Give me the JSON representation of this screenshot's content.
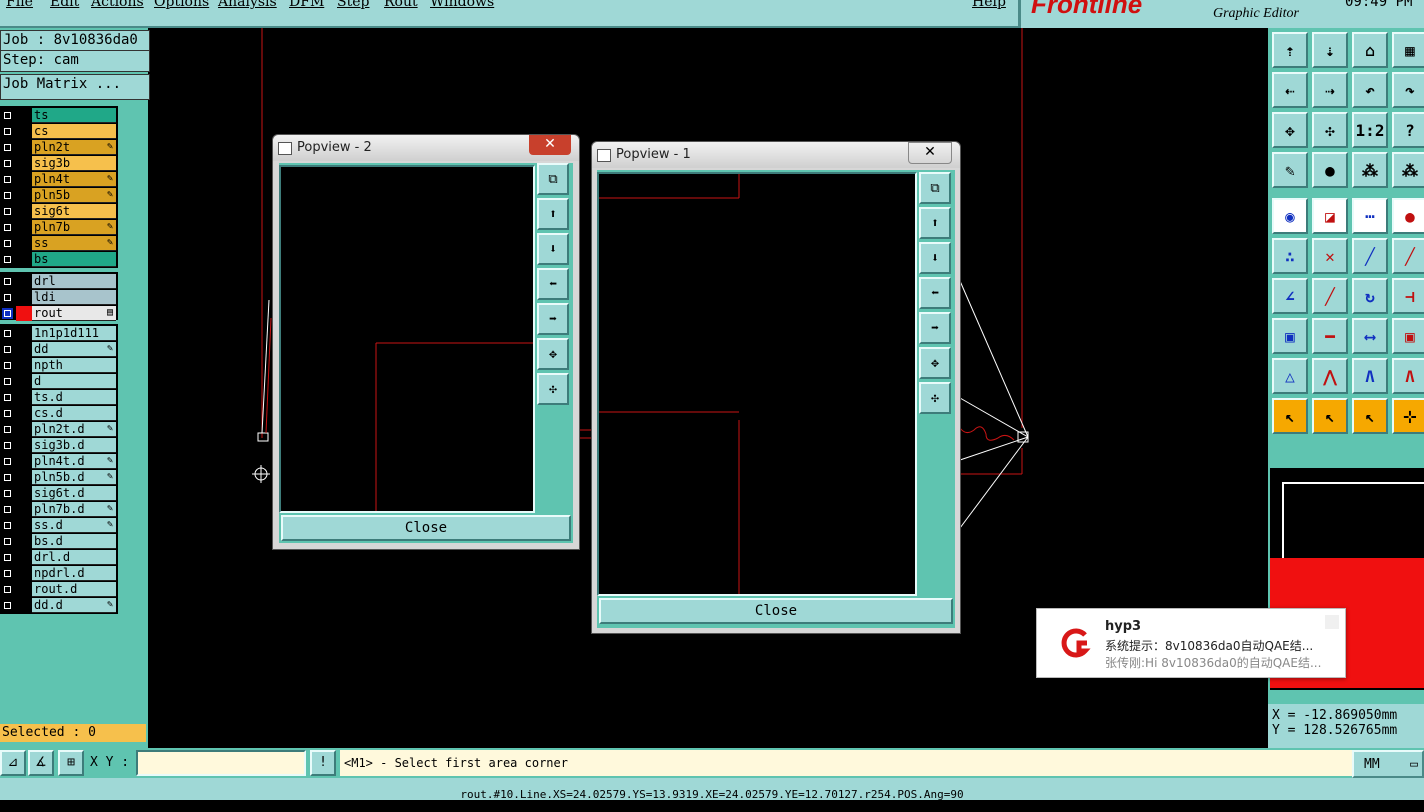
{
  "menu": {
    "items": [
      "File",
      "Edit",
      "Actions",
      "Options",
      "Analysis",
      "DFM",
      "Step",
      "Rout",
      "Windows",
      "Help"
    ]
  },
  "brand": {
    "logo": "Frontline",
    "subtitle": "Graphic Editor",
    "clock": "09:49 PM"
  },
  "job": {
    "job_label": "Job : 8v10836da0",
    "step_label": "Step: cam",
    "matrix_label": "Job Matrix ..."
  },
  "layers": {
    "board": [
      {
        "name": "ts",
        "color": "#20a888",
        "mark": ""
      },
      {
        "name": "cs",
        "color": "#f6c04c",
        "mark": ""
      },
      {
        "name": "pln2t",
        "color": "#d9a222",
        "mark": "✎"
      },
      {
        "name": "sig3b",
        "color": "#f6c04c",
        "mark": ""
      },
      {
        "name": "pln4t",
        "color": "#d9a222",
        "mark": "✎"
      },
      {
        "name": "pln5b",
        "color": "#d9a222",
        "mark": "✎"
      },
      {
        "name": "sig6t",
        "color": "#f6c04c",
        "mark": ""
      },
      {
        "name": "pln7b",
        "color": "#d9a222",
        "mark": "✎"
      },
      {
        "name": "ss",
        "color": "#d9a222",
        "mark": "✎"
      },
      {
        "name": "bs",
        "color": "#20a888",
        "mark": ""
      }
    ],
    "drill": [
      {
        "name": "drl",
        "color": "#a8c4cc",
        "mark": ""
      },
      {
        "name": "ldi",
        "color": "#a8c4cc",
        "mark": ""
      },
      {
        "name": "rout",
        "color": "#e8e8e8",
        "mark": "▤",
        "active": true
      }
    ],
    "misc": [
      {
        "name": "1n1p1d111",
        "mark": ""
      },
      {
        "name": "dd",
        "mark": "✎"
      },
      {
        "name": "npth",
        "mark": ""
      },
      {
        "name": "d",
        "mark": ""
      },
      {
        "name": "ts.d",
        "mark": ""
      },
      {
        "name": "cs.d",
        "mark": ""
      },
      {
        "name": "pln2t.d",
        "mark": "✎"
      },
      {
        "name": "sig3b.d",
        "mark": ""
      },
      {
        "name": "pln4t.d",
        "mark": "✎"
      },
      {
        "name": "pln5b.d",
        "mark": "✎"
      },
      {
        "name": "sig6t.d",
        "mark": ""
      },
      {
        "name": "pln7b.d",
        "mark": "✎"
      },
      {
        "name": "ss.d",
        "mark": "✎"
      },
      {
        "name": "bs.d",
        "mark": ""
      },
      {
        "name": "drl.d",
        "mark": ""
      },
      {
        "name": "npdrl.d",
        "mark": ""
      },
      {
        "name": "rout.d",
        "mark": ""
      },
      {
        "name": "dd.d",
        "mark": "✎"
      }
    ]
  },
  "selected": "Selected : 0",
  "popview2": {
    "title": "Popview - 2",
    "close": "Close"
  },
  "popview1": {
    "title": "Popview - 1",
    "close": "Close"
  },
  "commandline": {
    "xy_label": "X Y :",
    "xy_value": "",
    "prompt": "<M1> - Select first area corner",
    "units": "MM"
  },
  "coords": {
    "x": "X = -12.869050mm",
    "y": "Y = 128.526765mm"
  },
  "status": "rout.#10.Line.XS=24.02579.YS=13.9319.XE=24.02579.YE=12.70127.r254.POS.Ang=90",
  "notification": {
    "title": "hyp3",
    "line1": "系统提示：8v10836da0自动QAE结...",
    "line2": "张传刚:Hi 8v10836da0的自动QAE结..."
  }
}
